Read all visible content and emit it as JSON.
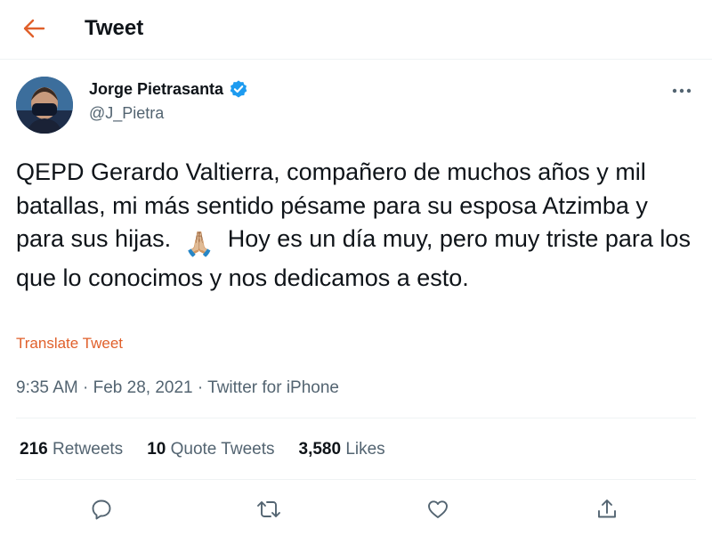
{
  "header": {
    "title": "Tweet",
    "back_icon": "back-arrow-icon",
    "accent_color": "#e0602b"
  },
  "author": {
    "name": "Jorge Pietrasanta",
    "handle": "@J_Pietra",
    "verified": true,
    "avatar_icon": "user-avatar"
  },
  "tweet": {
    "text_part1": "QEPD Gerardo Valtierra, compañero de muchos años y mil batallas, mi más sentido pésame para su esposa Atzimba y para sus hijas.  ",
    "emoji": "🙏🏼",
    "text_part2": "  Hoy es un día muy, pero muy triste para los  que lo conocimos y nos dedicamos a esto.",
    "translate_label": "Translate Tweet"
  },
  "meta": {
    "time": "9:35 AM",
    "date": "Feb 28, 2021",
    "source": "Twitter for iPhone",
    "separator": "·"
  },
  "stats": [
    {
      "count": "216",
      "label": "Retweets"
    },
    {
      "count": "10",
      "label": "Quote Tweets"
    },
    {
      "count": "3,580",
      "label": "Likes"
    }
  ],
  "actions": [
    "reply-icon",
    "retweet-icon",
    "like-icon",
    "share-icon"
  ]
}
